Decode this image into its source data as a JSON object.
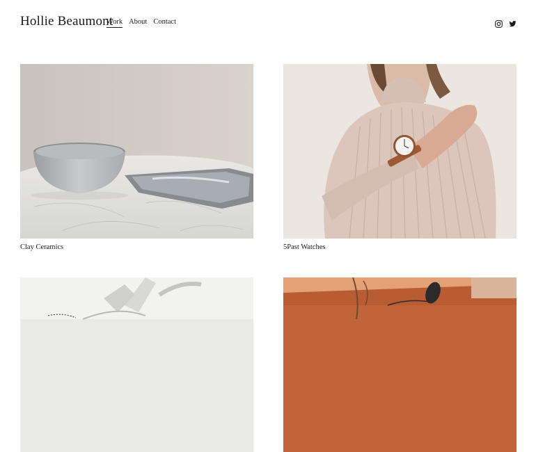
{
  "site": {
    "title": "Hollie Beaumont"
  },
  "nav": {
    "items": [
      {
        "label": "Work",
        "active": true
      },
      {
        "label": "About",
        "active": false
      },
      {
        "label": "Contact",
        "active": false
      }
    ]
  },
  "social": {
    "icons": [
      "instagram-icon",
      "twitter-icon"
    ]
  },
  "projects": [
    {
      "title": "Clay Ceramics",
      "image": "bowl-on-marble-table"
    },
    {
      "title": "5Past Watches",
      "image": "woman-wearing-watch"
    },
    {
      "title": "",
      "image": "white-object-on-marble"
    },
    {
      "title": "",
      "image": "sunglasses-on-orange-backdrop"
    }
  ],
  "colors": {
    "text": "#1a1a1a",
    "background": "#ffffff"
  }
}
